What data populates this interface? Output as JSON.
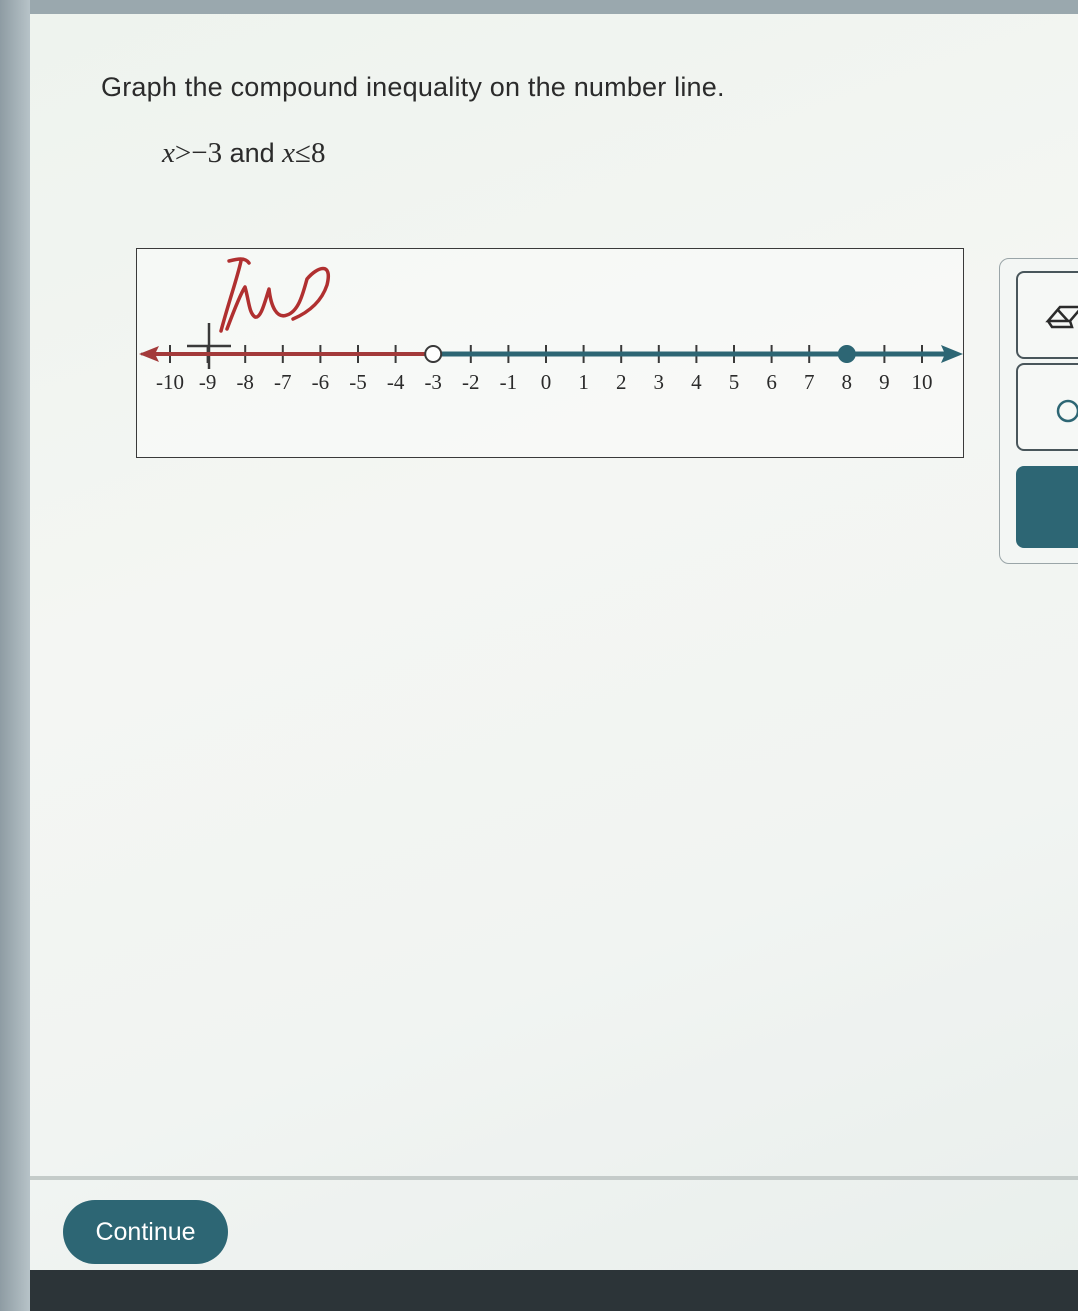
{
  "question": {
    "instruction": "Graph the compound inequality on the number line.",
    "inequality": {
      "var1": "x",
      "op1": ">",
      "val1": "−3",
      "conj": " and ",
      "var2": "x",
      "op2": "≤",
      "val2": "8"
    }
  },
  "number_line": {
    "min": -10,
    "max": 10,
    "step": 1,
    "tick_labels": [
      "-10",
      "-9",
      "-8",
      "-7",
      "-6",
      "-5",
      "-4",
      "-3",
      "-2",
      "-1",
      "0",
      "1",
      "2",
      "3",
      "4",
      "5",
      "6",
      "7",
      "8",
      "9",
      "10"
    ],
    "open_point": -3,
    "closed_point": 8,
    "shaded_interval": [
      -3,
      8
    ],
    "left_ray_to": -3,
    "colors": {
      "interval": "#2d6674",
      "left_ray": "#a33a3a",
      "axis": "#3a3a3a",
      "scribble": "#b03030"
    }
  },
  "tools": [
    {
      "name": "eraser-tool",
      "icon": "eraser-icon"
    },
    {
      "name": "open-point-tool",
      "icon": "open-circle-icon"
    },
    {
      "name": "submit-tool",
      "icon": ""
    }
  ],
  "footer": {
    "continue_label": "Continue"
  },
  "colors": {
    "accent": "#2d6674"
  }
}
